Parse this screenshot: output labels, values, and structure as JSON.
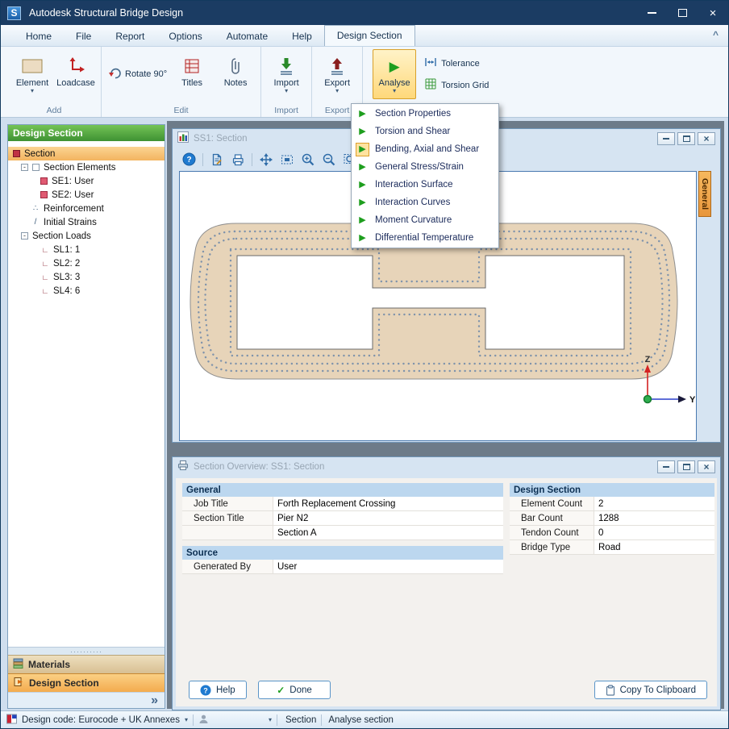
{
  "icons": {
    "logo": "S",
    "minimize": "–",
    "close": "×",
    "caret": "▾",
    "chevron_up": "^",
    "play": "▶",
    "help": "?",
    "check": "✓",
    "collapse": "»",
    "load_angle": "∟",
    "reinf_dots": "∴",
    "strain_slash": "/",
    "expander_minus": "-",
    "splitter_dots": "··········"
  },
  "titlebar": {
    "title": "Autodesk Structural Bridge Design"
  },
  "tabs": {
    "items": [
      "Home",
      "File",
      "Report",
      "Options",
      "Automate",
      "Help",
      "Design Section"
    ]
  },
  "ribbon": {
    "element": "Element",
    "loadcase": "Loadcase",
    "add_group": "Add",
    "rotate": "Rotate 90°",
    "titles": "Titles",
    "notes": "Notes",
    "edit_group": "Edit",
    "import": "Import",
    "import_group": "Import",
    "export": "Export",
    "export_group": "Export",
    "analyse": "Analyse",
    "tolerance": "Tolerance",
    "torsion_grid": "Torsion Grid"
  },
  "analyse_menu": {
    "items": [
      "Section Properties",
      "Torsion and Shear",
      "Bending, Axial and Shear",
      "General Stress/Strain",
      "Interaction Surface",
      "Interaction Curves",
      "Moment Curvature",
      "Differential Temperature"
    ],
    "highlighted": "Bending, Axial and Shear"
  },
  "sidebar": {
    "header": "Design Section",
    "tree": [
      {
        "label": "Section"
      },
      {
        "label": "Section Elements"
      },
      {
        "label": "SE1: User"
      },
      {
        "label": "SE2: User"
      },
      {
        "label": "Reinforcement"
      },
      {
        "label": "Initial Strains"
      },
      {
        "label": "Section Loads"
      },
      {
        "label": "SL1: 1"
      },
      {
        "label": "SL2: 2"
      },
      {
        "label": "SL3: 3"
      },
      {
        "label": "SL4: 6"
      }
    ],
    "materials_bar": "Materials",
    "design_section_bar": "Design Section"
  },
  "section_window": {
    "title": "SS1: Section",
    "side_tab": "General",
    "axis_z": "Z",
    "axis_y": "Y"
  },
  "overview_window": {
    "title": "Section Overview: SS1: Section",
    "general_header": "General",
    "general_rows": [
      {
        "label": "Job Title",
        "value": "Forth Replacement Crossing"
      },
      {
        "label": "Section Title",
        "value": "Pier N2"
      },
      {
        "label": "",
        "value": "Section A"
      }
    ],
    "source_header": "Source",
    "source_rows": [
      {
        "label": "Generated By",
        "value": "User"
      }
    ],
    "design_header": "Design Section",
    "design_rows": [
      {
        "label": "Element Count",
        "value": "2"
      },
      {
        "label": "Bar Count",
        "value": "1288"
      },
      {
        "label": "Tendon Count",
        "value": "0"
      },
      {
        "label": "Bridge Type",
        "value": "Road"
      }
    ],
    "help_button": "Help",
    "done_button": "Done",
    "copy_button": "Copy To Clipboard"
  },
  "statusbar": {
    "design_code": "Design code: Eurocode + UK Annexes",
    "section": "Section",
    "analyse": "Analyse section"
  },
  "colors": {
    "titlebar": "#1b3c63",
    "sidebar_header_green": "#4ea63e",
    "selection_orange": "#f3b45f",
    "section_fill": "#e7d4b9",
    "accent_blue": "#2f6ca8"
  }
}
